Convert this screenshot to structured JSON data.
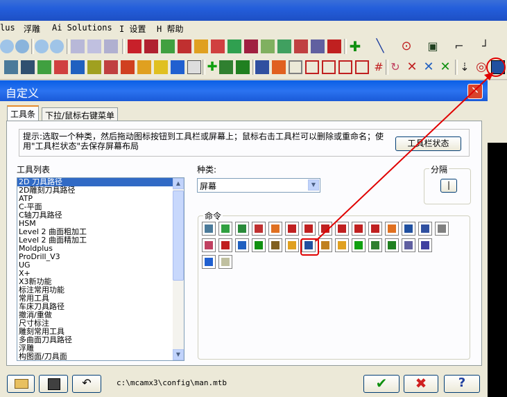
{
  "menu": {
    "items": [
      "lus",
      "浮雕",
      "Ai Solutions",
      "I 设置",
      "H 帮助"
    ]
  },
  "dialog": {
    "title": "自定义",
    "close_glyph": "✕",
    "tabs": [
      "工具条",
      "下拉/鼠标右键菜单"
    ],
    "hint": "提示:选取一个种类，然后拖动图标按钮到工具栏或屏幕上；鼠标右击工具栏可以删除或重命名；使用\"工具栏状态\"去保存屏幕布局",
    "toolbar_state_button": "工具栏状态",
    "toolbar_list_label": "工具列表",
    "toolbar_list": [
      "2D 刀具路径",
      "2D雕刻刀具路径",
      "ATP",
      "C-平面",
      "C轴刀具路径",
      "HSM",
      "Level 2 曲面粗加工",
      "Level 2 曲面精加工",
      "Moldplus",
      "ProDrill_V3",
      "UG",
      "X+",
      "X3新功能",
      "标注常用功能",
      "常用工具",
      "车床刀具路径",
      "撤消/重做",
      "尺寸标注",
      "雕刻常用工具",
      "多曲面刀具路径",
      "浮雕",
      "构图面/刀具面"
    ],
    "category_label": "种类:",
    "category_value": "屏幕",
    "separator_label": "分隔",
    "commands_label": "命令",
    "file_path": "c:\\mcamx3\\config\\man.mtb"
  },
  "colors": {
    "annotation": "#e00000",
    "accent_blue": "#316ac5"
  }
}
